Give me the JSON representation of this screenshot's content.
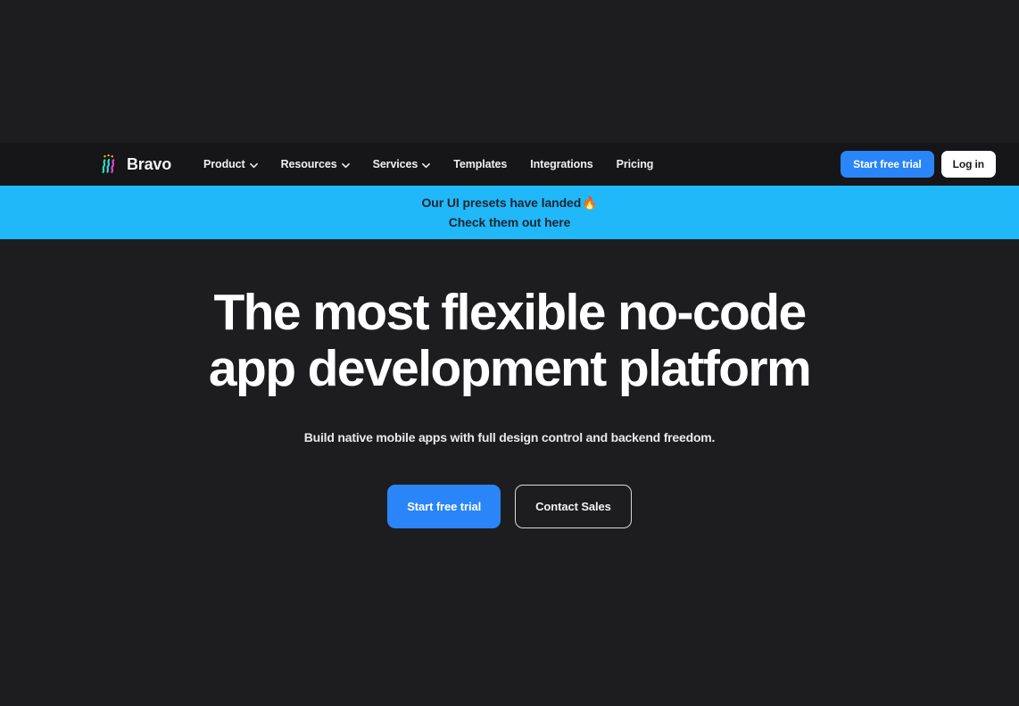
{
  "brand": {
    "name": "Bravo",
    "mark_colors": [
      "#2fe0b0",
      "#e94bd0",
      "#f5c518"
    ]
  },
  "nav": {
    "links": [
      {
        "label": "Product",
        "has_dropdown": true
      },
      {
        "label": "Resources",
        "has_dropdown": true
      },
      {
        "label": "Services",
        "has_dropdown": true
      },
      {
        "label": "Templates",
        "has_dropdown": false
      },
      {
        "label": "Integrations",
        "has_dropdown": false
      },
      {
        "label": "Pricing",
        "has_dropdown": false
      }
    ],
    "trial_label": "Start free trial",
    "login_label": "Log in"
  },
  "banner": {
    "line1": "Our UI presets have landed",
    "emoji": "🔥",
    "line2": "Check them out here",
    "background": "#21b8fa",
    "text_color": "#18262e"
  },
  "hero": {
    "title": "The most flexible no-code app development platform",
    "subtitle": "Build native mobile apps with full design control and backend freedom.",
    "primary_cta": "Start free trial",
    "secondary_cta": "Contact Sales"
  },
  "theme": {
    "page_background": "#1d1d1f",
    "navbar_background": "#161618",
    "accent_blue": "#2a85f8",
    "banner_blue": "#21b8fa"
  }
}
